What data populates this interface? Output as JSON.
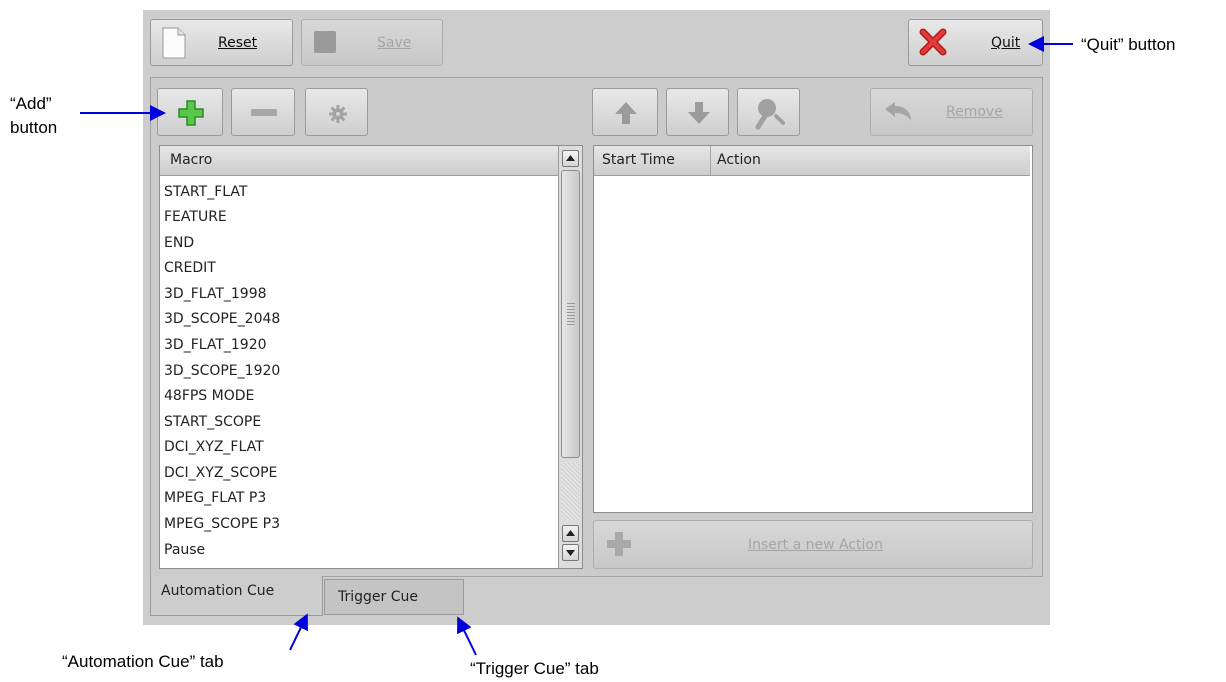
{
  "toolbar": {
    "reset_label": "Reset",
    "save_label": "Save",
    "quit_label": "Quit"
  },
  "macros": {
    "header": "Macro",
    "items": [
      "START_FLAT",
      "FEATURE",
      "END",
      "CREDIT",
      "3D_FLAT_1998",
      "3D_SCOPE_2048",
      "3D_FLAT_1920",
      "3D_SCOPE_1920",
      "48FPS MODE",
      "START_SCOPE",
      "DCI_XYZ_FLAT",
      "DCI_XYZ_SCOPE",
      "MPEG_FLAT P3",
      "MPEG_SCOPE P3",
      "Pause"
    ]
  },
  "actions": {
    "col_start_time": "Start Time",
    "col_action": "Action",
    "remove_label": "Remove",
    "insert_label": "Insert a new Action"
  },
  "tabs": {
    "automation": "Automation Cue",
    "trigger": "Trigger Cue"
  },
  "annotations": {
    "add_line1": "“Add”",
    "add_line2": "button",
    "quit": "“Quit” button",
    "automation_tab": "“Automation Cue” tab",
    "trigger_tab": "“Trigger Cue” tab"
  }
}
